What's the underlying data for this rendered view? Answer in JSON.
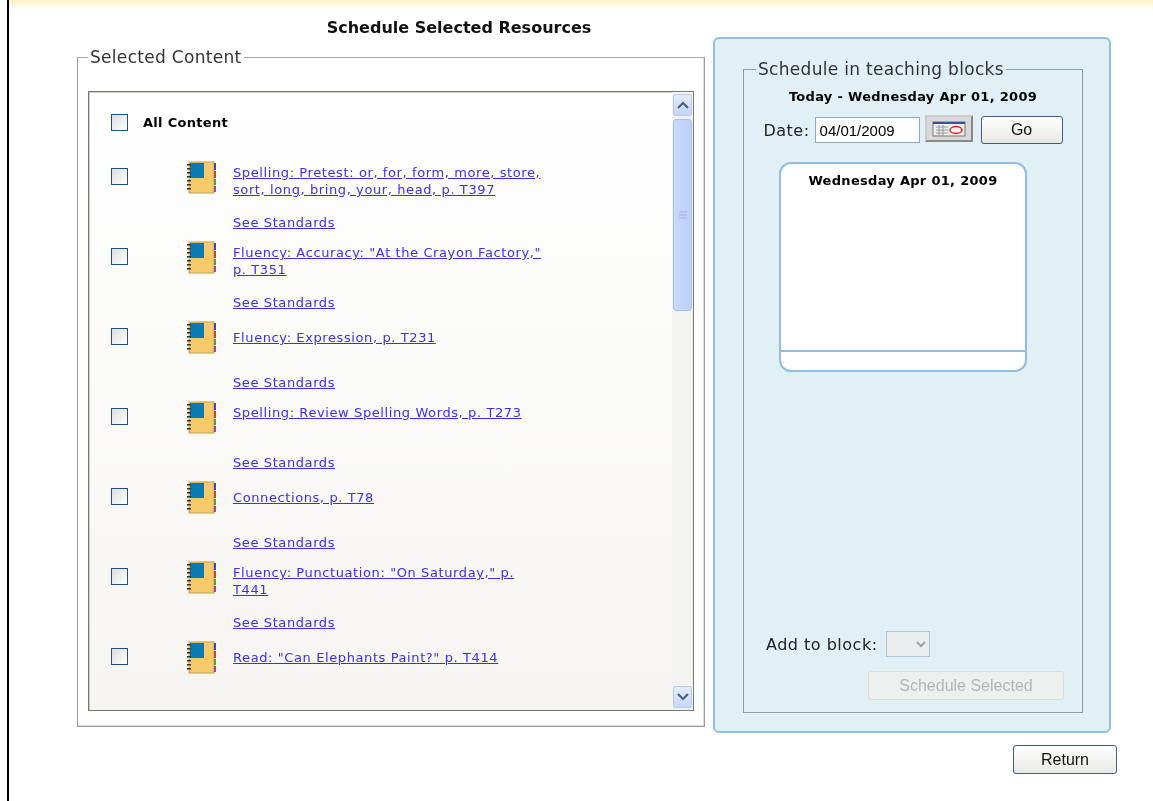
{
  "title": "Schedule Selected Resources",
  "selected_content": {
    "legend": "Selected Content",
    "all": {
      "label": "All Content",
      "checked": false
    },
    "items": [
      {
        "title": "Spelling: Pretest: or, for, form, more, store, sort, long, bring, your, head, p. T397",
        "checked": false,
        "standards_link": "See Standards"
      },
      {
        "title": "Fluency: Accuracy: \"At the Crayon Factory,\" p. T351",
        "checked": false,
        "standards_link": "See Standards"
      },
      {
        "title": "Fluency: Expression, p. T231",
        "checked": false,
        "standards_link": "See Standards"
      },
      {
        "title": "Spelling: Review Spelling Words, p. T273",
        "checked": false,
        "standards_link": "See Standards"
      },
      {
        "title": "Connections, p. T78",
        "checked": false,
        "standards_link": "See Standards"
      },
      {
        "title": "Fluency: Punctuation: \"On Saturday,\" p. T441",
        "checked": false,
        "standards_link": "See Standards"
      },
      {
        "title": "Read: \"Can Elephants Paint?\" p. T414",
        "checked": false
      }
    ]
  },
  "schedule": {
    "legend": "Schedule in teaching blocks",
    "today": "Today - Wednesday Apr 01, 2009",
    "date_label": "Date:",
    "date_value": "04/01/2009",
    "go_button": "Go",
    "day_card": {
      "title": "Wednesday Apr 01, 2009"
    },
    "add_label": "Add to block:",
    "block_select": {
      "disabled": true
    },
    "schedule_button": {
      "label": "Schedule Selected",
      "disabled": true
    }
  },
  "return_button": "Return"
}
